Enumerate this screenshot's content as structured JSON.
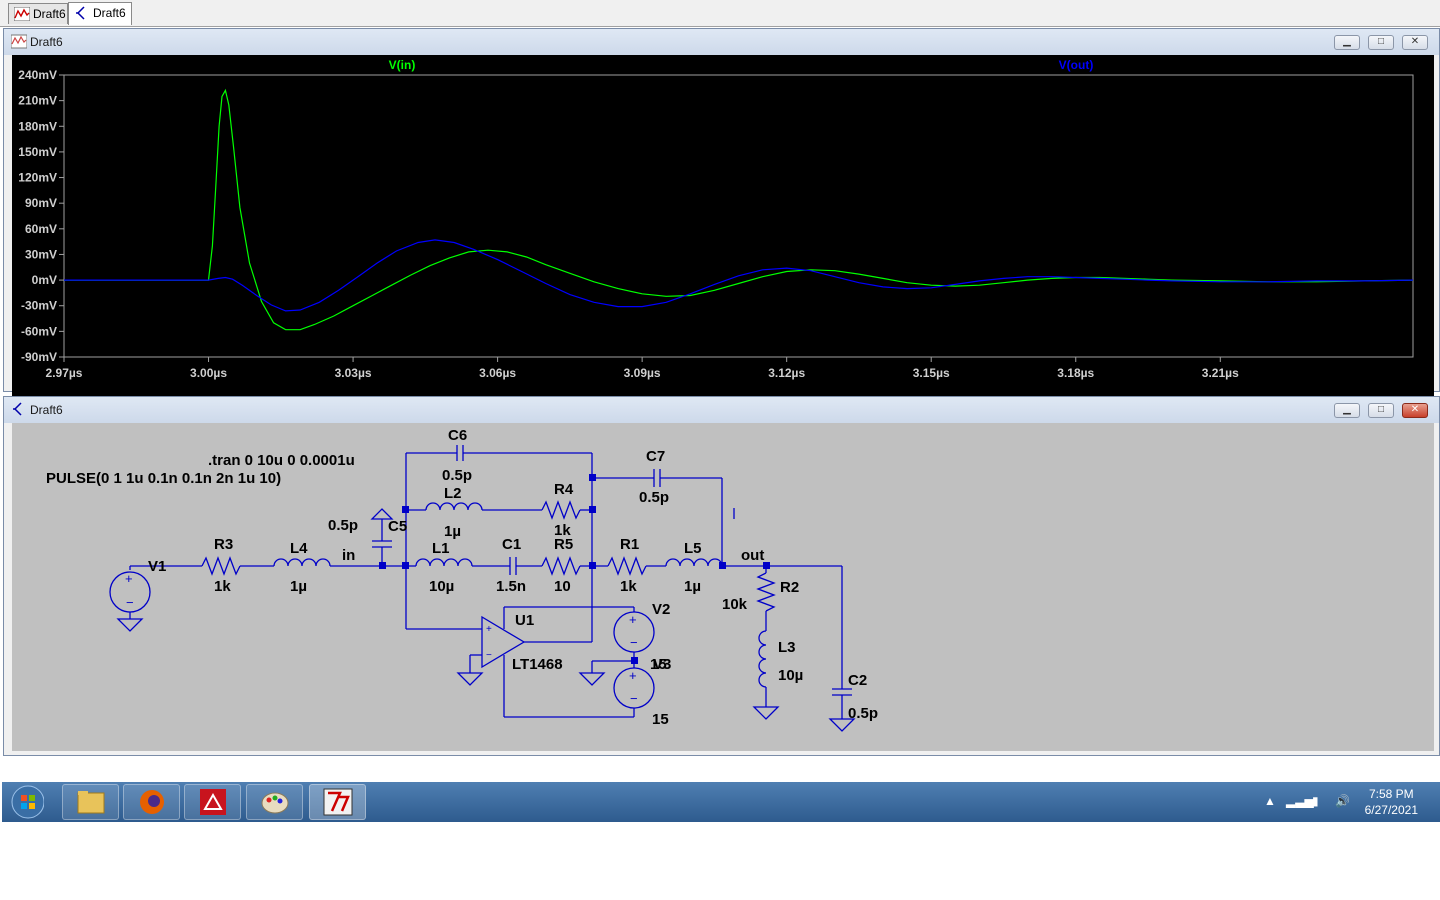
{
  "tabs": [
    {
      "label": "Draft6",
      "icon": "waveform-icon"
    },
    {
      "label": "Draft6",
      "icon": "schematic-icon"
    }
  ],
  "plot_window": {
    "title": "Draft6",
    "minimize": "▁",
    "maximize": "□",
    "close": "✕"
  },
  "schematic_window": {
    "title": "Draft6",
    "minimize": "▁",
    "maximize": "□",
    "close": "✕"
  },
  "chart_data": {
    "type": "line",
    "title": "",
    "xlabel": "",
    "ylabel": "",
    "xlim": [
      2.97,
      3.25
    ],
    "ylim": [
      -90,
      240
    ],
    "x_ticks": [
      "2.97µs",
      "3.00µs",
      "3.03µs",
      "3.06µs",
      "3.09µs",
      "3.12µs",
      "3.15µs",
      "3.18µs",
      "3.21µs"
    ],
    "y_ticks": [
      "240mV",
      "210mV",
      "180mV",
      "150mV",
      "120mV",
      "90mV",
      "60mV",
      "30mV",
      "0mV",
      "-30mV",
      "-60mV",
      "-90mV"
    ],
    "grid": false,
    "series": [
      {
        "name": "V(in)",
        "color": "#00ff00",
        "x": [
          2.97,
          3.0,
          3.0008,
          3.0015,
          3.0022,
          3.0028,
          3.0035,
          3.0042,
          3.0052,
          3.0065,
          3.0085,
          3.011,
          3.0135,
          3.016,
          3.019,
          3.022,
          3.026,
          3.03,
          3.034,
          3.038,
          3.042,
          3.046,
          3.05,
          3.054,
          3.058,
          3.062,
          3.066,
          3.07,
          3.075,
          3.08,
          3.085,
          3.09,
          3.095,
          3.1,
          3.105,
          3.11,
          3.115,
          3.12,
          3.125,
          3.13,
          3.135,
          3.14,
          3.145,
          3.15,
          3.155,
          3.16,
          3.165,
          3.17,
          3.175,
          3.18,
          3.185,
          3.19,
          3.195,
          3.2,
          3.21,
          3.22,
          3.23,
          3.24,
          3.25
        ],
        "y": [
          0,
          0,
          40,
          110,
          180,
          215,
          222,
          205,
          155,
          85,
          20,
          -25,
          -50,
          -58,
          -58,
          -52,
          -42,
          -30,
          -18,
          -6,
          6,
          17,
          26,
          33,
          35,
          33,
          27,
          18,
          8,
          -2,
          -10,
          -16,
          -19,
          -18,
          -12,
          -4,
          4,
          10,
          12,
          11,
          7,
          2,
          -3,
          -6,
          -7,
          -6,
          -3,
          0,
          2,
          3,
          3,
          2,
          1,
          0,
          -1,
          -2,
          -2,
          -1,
          0
        ]
      },
      {
        "name": "V(out)",
        "color": "#0000ff",
        "x": [
          2.97,
          3.0,
          3.002,
          3.0035,
          3.005,
          3.007,
          3.01,
          3.013,
          3.016,
          3.019,
          3.023,
          3.027,
          3.031,
          3.035,
          3.039,
          3.0435,
          3.047,
          3.051,
          3.055,
          3.06,
          3.065,
          3.07,
          3.075,
          3.08,
          3.085,
          3.09,
          3.095,
          3.1,
          3.105,
          3.11,
          3.115,
          3.12,
          3.125,
          3.13,
          3.135,
          3.14,
          3.145,
          3.15,
          3.155,
          3.16,
          3.165,
          3.17,
          3.175,
          3.18,
          3.185,
          3.19,
          3.195,
          3.2,
          3.21,
          3.22,
          3.23,
          3.24,
          3.25
        ],
        "y": [
          0,
          0,
          2,
          3,
          1,
          -6,
          -18,
          -29,
          -36,
          -35,
          -26,
          -12,
          4,
          20,
          34,
          44,
          47,
          44,
          36,
          24,
          10,
          -4,
          -17,
          -26,
          -31,
          -31,
          -26,
          -16,
          -5,
          5,
          12,
          14,
          11,
          4,
          -3,
          -8,
          -10,
          -9,
          -5,
          -1,
          2,
          4,
          4,
          3,
          2,
          1,
          0,
          -1,
          -2,
          -2,
          -1,
          -1,
          0
        ]
      }
    ]
  },
  "schematic": {
    "directive": ".tran 0 10u 0 0.0001u",
    "pulse": "PULSE(0 1 1u 0.1n 0.1n 2n 1u 10)",
    "labels": {
      "V1": "V1",
      "R3": "R3",
      "R3v": "1k",
      "L4": "L4",
      "L4v": "1µ",
      "in": "in",
      "C5": "C5",
      "C5v": "0.5p",
      "C6": "C6",
      "C6v": "0.5p",
      "L2": "L2",
      "L2v": "1µ",
      "R4": "R4",
      "R4v": "1k",
      "C7": "C7",
      "C7v": "0.5p",
      "L1": "L1",
      "L1v": "10µ",
      "C1": "C1",
      "C1v": "1.5n",
      "R5": "R5",
      "R5v": "10",
      "R1": "R1",
      "R1v": "1k",
      "L5": "L5",
      "L5v": "1µ",
      "out": "out",
      "R2": "R2",
      "R2v": "10k",
      "L3": "L3",
      "L3v": "10µ",
      "C2": "C2",
      "C2v": "0.5p",
      "U1": "U1",
      "U1v": "LT1468",
      "V2": "V2",
      "V3": "V3",
      "V3b": "15",
      "V2v": "15"
    }
  },
  "taskbar": {
    "time": "7:58 PM",
    "date": "6/27/2021",
    "apps": [
      "start-orb-icon",
      "file-explorer-icon",
      "firefox-icon",
      "acrobat-icon",
      "paint-icon",
      "ltspice-icon"
    ]
  }
}
